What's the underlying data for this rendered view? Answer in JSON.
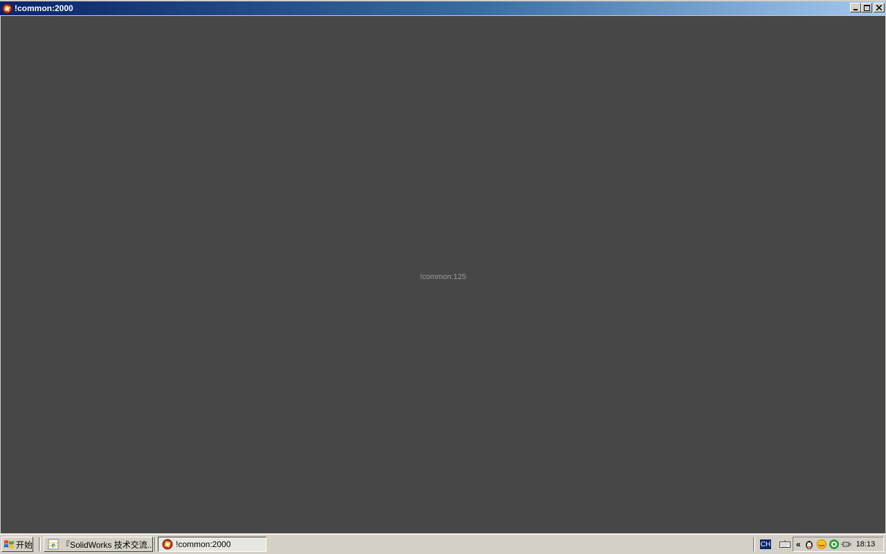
{
  "window": {
    "title": "!common:2000",
    "center_text": "!common:125"
  },
  "taskbar": {
    "start_label": "开始",
    "tasks": [
      {
        "label": "『SolidWorks 技术交流...",
        "icon": "ie-icon",
        "active": false
      },
      {
        "label": "!common:2000",
        "icon": "app-icon",
        "active": true
      }
    ],
    "language": "CH",
    "clock": "18:13",
    "tray_icons": [
      "keyboard-icon",
      "show-hidden-icon",
      "qq-penguin-icon",
      "qq-chat-icon",
      "green-circle-icon",
      "network-plug-icon"
    ]
  },
  "colors": {
    "titlebar_start": "#0a246a",
    "titlebar_end": "#a6caf0",
    "client_bg": "#474747",
    "center_text": "#9a9a9a",
    "chrome": "#d4d0c8"
  }
}
